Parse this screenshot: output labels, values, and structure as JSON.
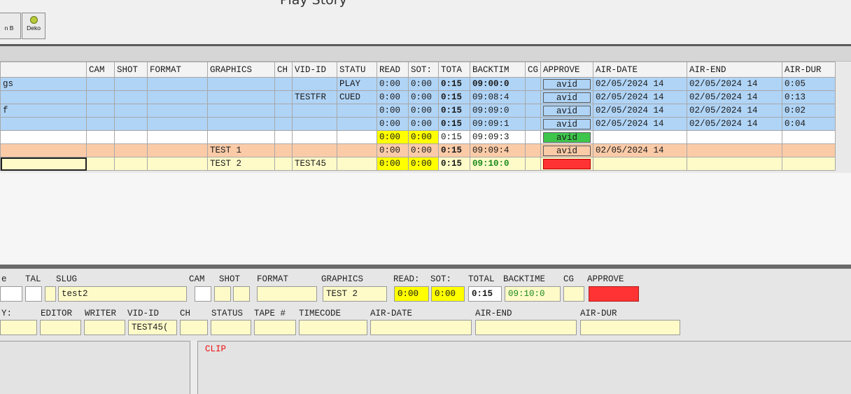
{
  "toolbar": {
    "title": "Play Story",
    "buttons": [
      {
        "label": "n B",
        "icon": "partial-icon"
      },
      {
        "label": "Deko",
        "icon": "deko-icon"
      }
    ]
  },
  "columns": [
    "",
    "CAM",
    "SHOT",
    "FORMAT",
    "GRAPHICS",
    "CH",
    "VID-ID",
    "STATU",
    "READ",
    "SOT:",
    "TOTA",
    "BACKTIM",
    "CG",
    "APPROVE",
    "AIR-DATE",
    "AIR-END",
    "AIR-DUR"
  ],
  "rows": [
    {
      "style": "blue",
      "slug": "gs",
      "graphics": "",
      "vid": "",
      "status": "PLAY",
      "read": "0:00",
      "sot": "0:00",
      "total": "0:15",
      "backtime": "09:00:0",
      "approve": "avid",
      "approve_style": "btn",
      "air_date": "02/05/2024 14",
      "air_end": "02/05/2024 14",
      "air_dur": "0:05"
    },
    {
      "style": "blue",
      "slug": "",
      "graphics": "",
      "vid": "TESTFR",
      "status": "CUED",
      "read": "0:00",
      "sot": "0:00",
      "total": "0:15",
      "backtime": "09:08:4",
      "approve": "avid",
      "approve_style": "btn",
      "air_date": "02/05/2024 14",
      "air_end": "02/05/2024 14",
      "air_dur": "0:13"
    },
    {
      "style": "blue",
      "slug": "f",
      "graphics": "",
      "vid": "",
      "status": "",
      "read": "0:00",
      "sot": "0:00",
      "total": "0:15",
      "backtime": "09:09:0",
      "approve": "avid",
      "approve_style": "btn",
      "air_date": "02/05/2024 14",
      "air_end": "02/05/2024 14",
      "air_dur": "0:02"
    },
    {
      "style": "blue",
      "slug": "",
      "graphics": "",
      "vid": "",
      "status": "",
      "read": "0:00",
      "sot": "0:00",
      "total": "0:15",
      "backtime": "09:09:1",
      "approve": "avid",
      "approve_style": "btn",
      "air_date": "02/05/2024 14",
      "air_end": "02/05/2024 14",
      "air_dur": "0:04"
    },
    {
      "style": "white",
      "slug": "",
      "graphics": "",
      "vid": "",
      "status": "",
      "read": "0:00",
      "sot": "0:00",
      "total": "0:15",
      "backtime": "09:09:3",
      "approve": "avid",
      "approve_style": "green",
      "air_date": "",
      "air_end": "",
      "air_dur": "",
      "read_hl": true,
      "total_plain": true
    },
    {
      "style": "orange",
      "slug": "",
      "graphics": "TEST 1",
      "vid": "",
      "status": "",
      "read": "0:00",
      "sot": "0:00",
      "total": "0:15",
      "backtime": "09:09:4",
      "approve": "avid",
      "approve_style": "btn",
      "air_date": "02/05/2024 14",
      "air_end": "",
      "air_dur": ""
    },
    {
      "style": "yellow",
      "slug": "",
      "graphics": "TEST 2",
      "vid": "TEST45",
      "status": "",
      "read": "0:00",
      "sot": "0:00",
      "total": "0:15",
      "backtime": "09:10:0",
      "approve": "",
      "approve_style": "red",
      "air_date": "",
      "air_end": "",
      "air_dur": "",
      "read_hl": true,
      "backtime_green": true,
      "focus": true
    }
  ],
  "editor": {
    "row1_labels": {
      "e": "e",
      "tal": "TAL",
      "slug": "SLUG",
      "cam": "CAM",
      "shot": "SHOT",
      "format": "FORMAT",
      "graphics": "GRAPHICS",
      "read": "READ:",
      "sot": "SOT:",
      "total": "TOTAL",
      "backtime": "BACKTIME",
      "cg": "CG",
      "approve": "APPROVE"
    },
    "row1_values": {
      "slug": "test2",
      "graphics": "TEST 2",
      "read": "0:00",
      "sot": "0:00",
      "total": "0:15",
      "backtime": "09:10:0"
    },
    "row2_labels": {
      "y": "Y:",
      "editor": "EDITOR",
      "writer": "WRITER",
      "vid": "VID-ID",
      "ch": "CH",
      "status": "STATUS",
      "tape": "TAPE #",
      "timecode": "TIMECODE",
      "air_date": "AIR-DATE",
      "air_end": "AIR-END",
      "air_dur": "AIR-DUR"
    },
    "row2_values": {
      "vid": "TEST45("
    },
    "clip_label": "CLIP"
  }
}
